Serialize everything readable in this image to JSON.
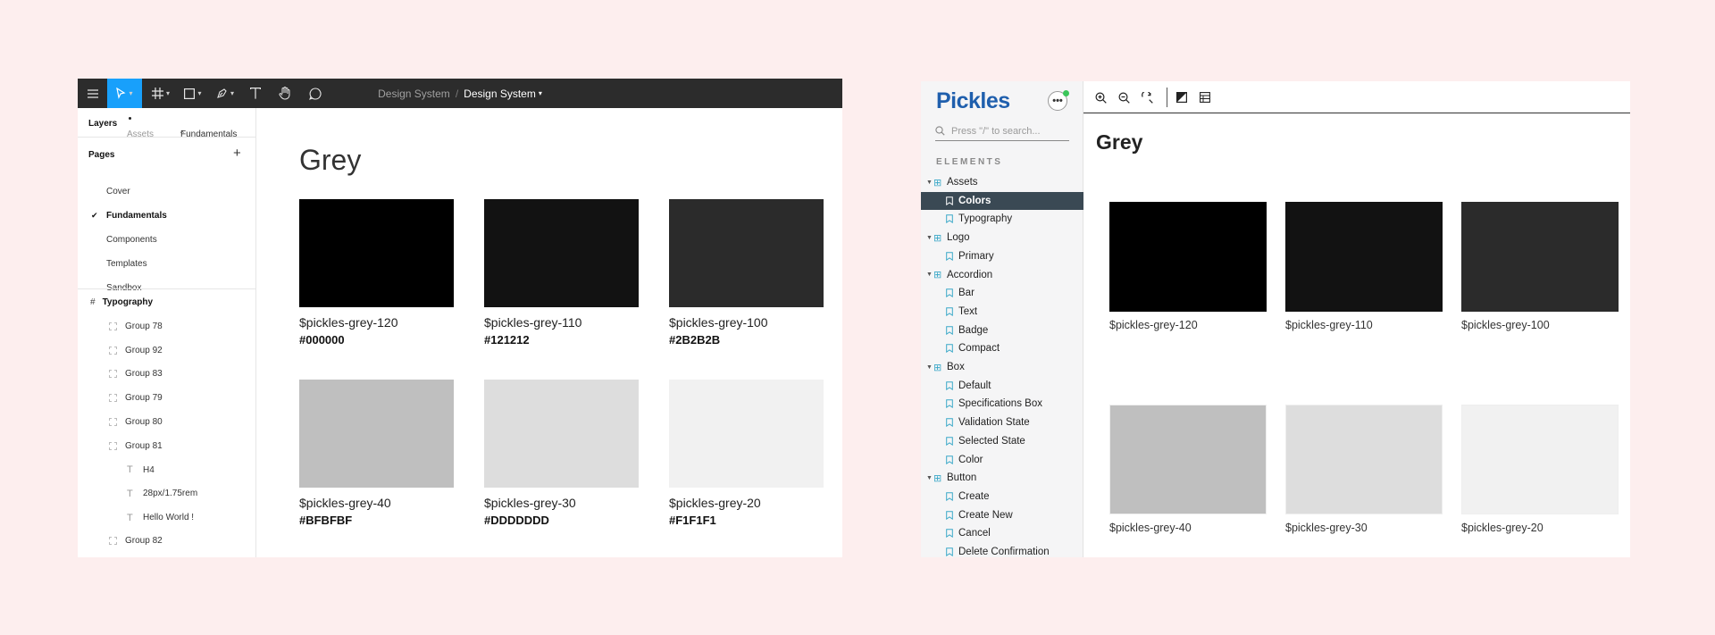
{
  "figma": {
    "breadcrumb": {
      "project": "Design System",
      "separator": "/",
      "file": "Design System"
    },
    "tabs": {
      "layers": "Layers",
      "assets": "Assets",
      "page_picker": "Fundamentals"
    },
    "pages": {
      "heading": "Pages",
      "add": "+",
      "items": [
        "Cover",
        "Fundamentals",
        "Components",
        "Templates",
        "Sandbox"
      ],
      "current_index": 1
    },
    "frame": "Typography",
    "layers": [
      "Group 78",
      "Group 92",
      "Group 83",
      "Group 79",
      "Group 80",
      "Group 81",
      "H4",
      "28px/1.75rem",
      "Hello World !",
      "Group 82"
    ],
    "canvas_title": "Grey",
    "swatches": [
      {
        "name": "$pickles-grey-120",
        "hex": "#000000"
      },
      {
        "name": "$pickles-grey-110",
        "hex": "#121212"
      },
      {
        "name": "$pickles-grey-100",
        "hex": "#2B2B2B"
      },
      {
        "name": "$pickles-grey-40",
        "hex": "#BFBFBF"
      },
      {
        "name": "$pickles-grey-30",
        "hex": "#DDDDDDD"
      },
      {
        "name": "$pickles-grey-20",
        "hex": "#F1F1F1"
      }
    ],
    "swatch_colors": [
      "#000000",
      "#121212",
      "#2b2b2b",
      "#bfbfbf",
      "#dddddd",
      "#f1f1f1"
    ]
  },
  "pickles": {
    "logo": "Pickles",
    "more": "•••",
    "search_placeholder": "Press \"/\" to search...",
    "section": "ELEMENTS",
    "nav": [
      {
        "type": "group",
        "label": "Assets"
      },
      {
        "type": "leaf",
        "label": "Colors",
        "selected": true
      },
      {
        "type": "leaf",
        "label": "Typography"
      },
      {
        "type": "group",
        "label": "Logo"
      },
      {
        "type": "leaf",
        "label": "Primary"
      },
      {
        "type": "group",
        "label": "Accordion"
      },
      {
        "type": "leaf",
        "label": "Bar"
      },
      {
        "type": "leaf",
        "label": "Text"
      },
      {
        "type": "leaf",
        "label": "Badge"
      },
      {
        "type": "leaf",
        "label": "Compact"
      },
      {
        "type": "group",
        "label": "Box"
      },
      {
        "type": "leaf",
        "label": "Default"
      },
      {
        "type": "leaf",
        "label": "Specifications Box"
      },
      {
        "type": "leaf",
        "label": "Validation State"
      },
      {
        "type": "leaf",
        "label": "Selected State"
      },
      {
        "type": "leaf",
        "label": "Color"
      },
      {
        "type": "group",
        "label": "Button"
      },
      {
        "type": "leaf",
        "label": "Create"
      },
      {
        "type": "leaf",
        "label": "Create New"
      },
      {
        "type": "leaf",
        "label": "Cancel"
      },
      {
        "type": "leaf",
        "label": "Delete Confirmation"
      }
    ],
    "content_title": "Grey",
    "swatches": [
      "$pickles-grey-120",
      "$pickles-grey-110",
      "$pickles-grey-100",
      "$pickles-grey-40",
      "$pickles-grey-30",
      "$pickles-grey-20"
    ],
    "swatch_colors": [
      "#000000",
      "#121212",
      "#2b2b2b",
      "#bfbfbf",
      "#dddddd",
      "#f1f1f1"
    ]
  },
  "colors": {
    "background": "#fdeeee",
    "figma_toolbar": "#2c2c2c",
    "figma_accent": "#18a0fb",
    "pickles_logo": "#1f5fad",
    "pickles_selected": "#3a4954",
    "status_dot": "#3bc55a"
  }
}
